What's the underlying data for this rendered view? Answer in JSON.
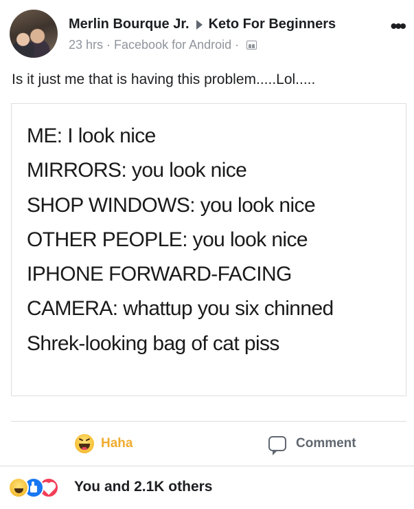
{
  "post": {
    "author": "Merlin Bourque Jr.",
    "group": "Keto For Beginners",
    "time": "23 hrs",
    "source": "Facebook for Android",
    "separator": "·",
    "more": "•••",
    "text": "Is it just me that is having this problem.....Lol....."
  },
  "meme": {
    "lines": [
      "ME: I look nice",
      "MIRRORS: you look nice",
      "SHOP WINDOWS: you look nice",
      "OTHER PEOPLE: you look nice",
      "IPHONE FORWARD-FACING",
      "CAMERA: whattup you six chinned",
      "Shrek-looking bag of cat piss"
    ]
  },
  "actions": {
    "haha_label": "Haha",
    "comment_label": "Comment"
  },
  "reactions": {
    "summary": "You and 2.1K others",
    "icons": [
      "haha-icon",
      "like-icon",
      "love-icon"
    ]
  },
  "colors": {
    "haha": "#f0ac2f",
    "like": "#1877f2",
    "love": "#f33e58",
    "meta": "#90949c"
  }
}
